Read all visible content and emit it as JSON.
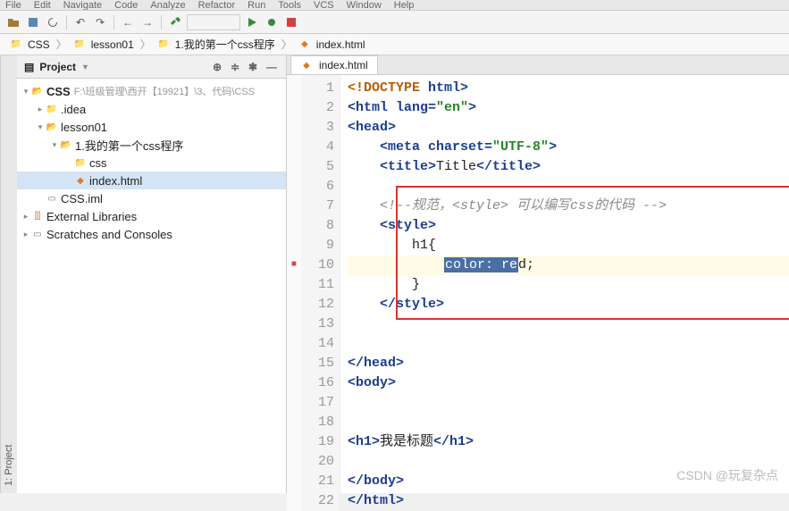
{
  "menubar": [
    "File",
    "Edit",
    "Navigate",
    "Code",
    "Analyze",
    "Refactor",
    "Run",
    "Tools",
    "VCS",
    "Window",
    "Help"
  ],
  "breadcrumb": {
    "items": [
      {
        "icon": "folder",
        "label": "CSS"
      },
      {
        "icon": "folder",
        "label": "lesson01"
      },
      {
        "icon": "folder",
        "label": "1.我的第一个css程序"
      },
      {
        "icon": "file-html",
        "label": "index.html"
      }
    ]
  },
  "panel_title": "Project",
  "sidebar_tab": "1: Project",
  "tree": {
    "root": {
      "label": "CSS",
      "sub": "F:\\班级管理\\西开【19921】\\3、代码\\CSS"
    },
    "idea": ".idea",
    "lesson": "lesson01",
    "app": "1.我的第一个css程序",
    "cssf": "css",
    "index": "index.html",
    "iml": "CSS.iml",
    "ext": "External Libraries",
    "scr": "Scratches and Consoles"
  },
  "editor_tab": "index.html",
  "code": {
    "l1_a": "<!DOCTYPE",
    "l1_b": " html",
    "l1_c": ">",
    "l2_a": "<html ",
    "l2_attr": "lang=",
    "l2_val": "\"en\"",
    "l2_c": ">",
    "l3": "<head>",
    "l4_a": "<meta ",
    "l4_attr": "charset=",
    "l4_val": "\"UTF-8\"",
    "l4_c": ">",
    "l5_a": "<title>",
    "l5_b": "Title",
    "l5_c": "</title>",
    "l7": "<!--规范，<style> 可以编写css的代码 -->",
    "l8": "<style>",
    "l9": "h1{",
    "l10_sel": "color: re",
    "l10_after": "d;",
    "l11": "}",
    "l12": "</style>",
    "l15": "</head>",
    "l16": "<body>",
    "l19_a": "<h1>",
    "l19_b": "我是标题",
    "l19_c": "</h1>",
    "l21": "</body>",
    "l22": "</html>"
  },
  "line_numbers": [
    1,
    2,
    3,
    4,
    5,
    6,
    7,
    8,
    9,
    10,
    11,
    12,
    13,
    14,
    15,
    16,
    17,
    18,
    19,
    20,
    21,
    22
  ],
  "watermark": "CSDN @玩复杂点"
}
